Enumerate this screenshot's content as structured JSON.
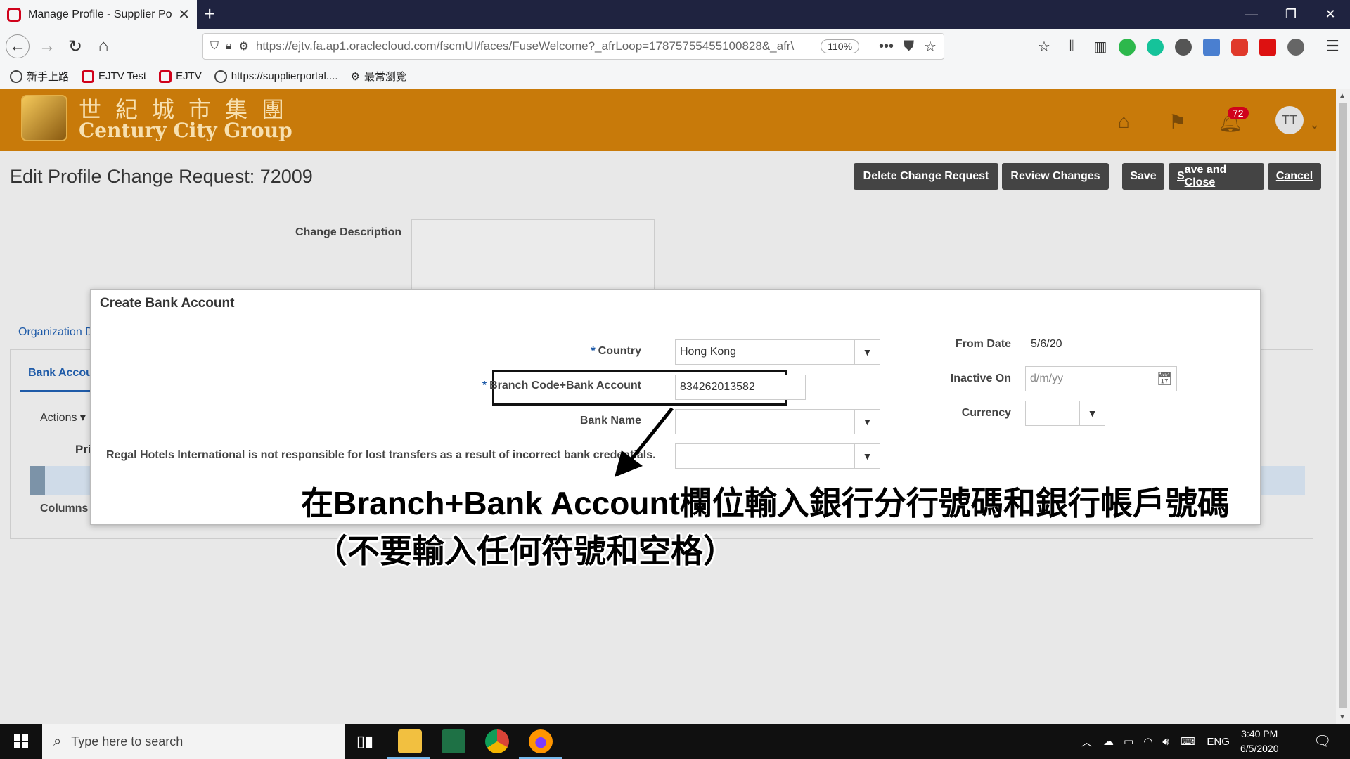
{
  "browser": {
    "tab_title": "Manage Profile - Supplier Porta",
    "url": "https://ejtv.fa.ap1.oraclecloud.com/fscmUI/faces/FuseWelcome?_afrLoop=17875755455100828&_afr\\",
    "zoom": "110%",
    "bookmarks": [
      "新手上路",
      "EJTV Test",
      "EJTV",
      "https://supplierportal....",
      "最常瀏覽"
    ]
  },
  "header": {
    "logo_cn": "世紀城市集團",
    "logo_en": "Century City Group",
    "notification_count": "72",
    "avatar_initials": "TT"
  },
  "page": {
    "title": "Edit Profile Change Request: 72009",
    "buttons": {
      "delete": "Delete Change Request",
      "review": "Review Changes",
      "save": "Save",
      "save_close_first": "S",
      "save_close_rest": "ave and Close",
      "cancel_first": "C",
      "cancel_rest": "ancel"
    },
    "change_description_label": "Change Description",
    "org_link": "Organization D",
    "bank_tab": "Bank Accou",
    "actions_label": "Actions ▾",
    "pri_label": "Pri",
    "columns_label": "Columns"
  },
  "dialog": {
    "title": "Create Bank Account",
    "country_label": "Country",
    "country_value": "Hong Kong",
    "branch_label": "Branch Code+Bank Account",
    "branch_value": "834262013582",
    "bank_name_label": "Bank Name",
    "disclaimer": "Regal Hotels International is not responsible for lost transfers as a result of incorrect bank credentials.",
    "from_date_label": "From Date",
    "from_date_value": "5/6/20",
    "inactive_on_label": "Inactive On",
    "inactive_on_placeholder": "d/m/yy",
    "currency_label": "Currency"
  },
  "annotation": {
    "line1": "在Branch+Bank Account欄位輸入銀行分行號碼和銀行帳戶號碼",
    "line2": "（不要輸入任何符號和空格）"
  },
  "taskbar": {
    "search_placeholder": "Type here to search",
    "language": "ENG",
    "time": "3:40 PM",
    "date": "6/5/2020"
  },
  "colors": {
    "header_orange": "#c87a0a",
    "button_dark": "#444444",
    "link_blue": "#1f5ba8",
    "tab_bar_navy": "#1f2340"
  }
}
